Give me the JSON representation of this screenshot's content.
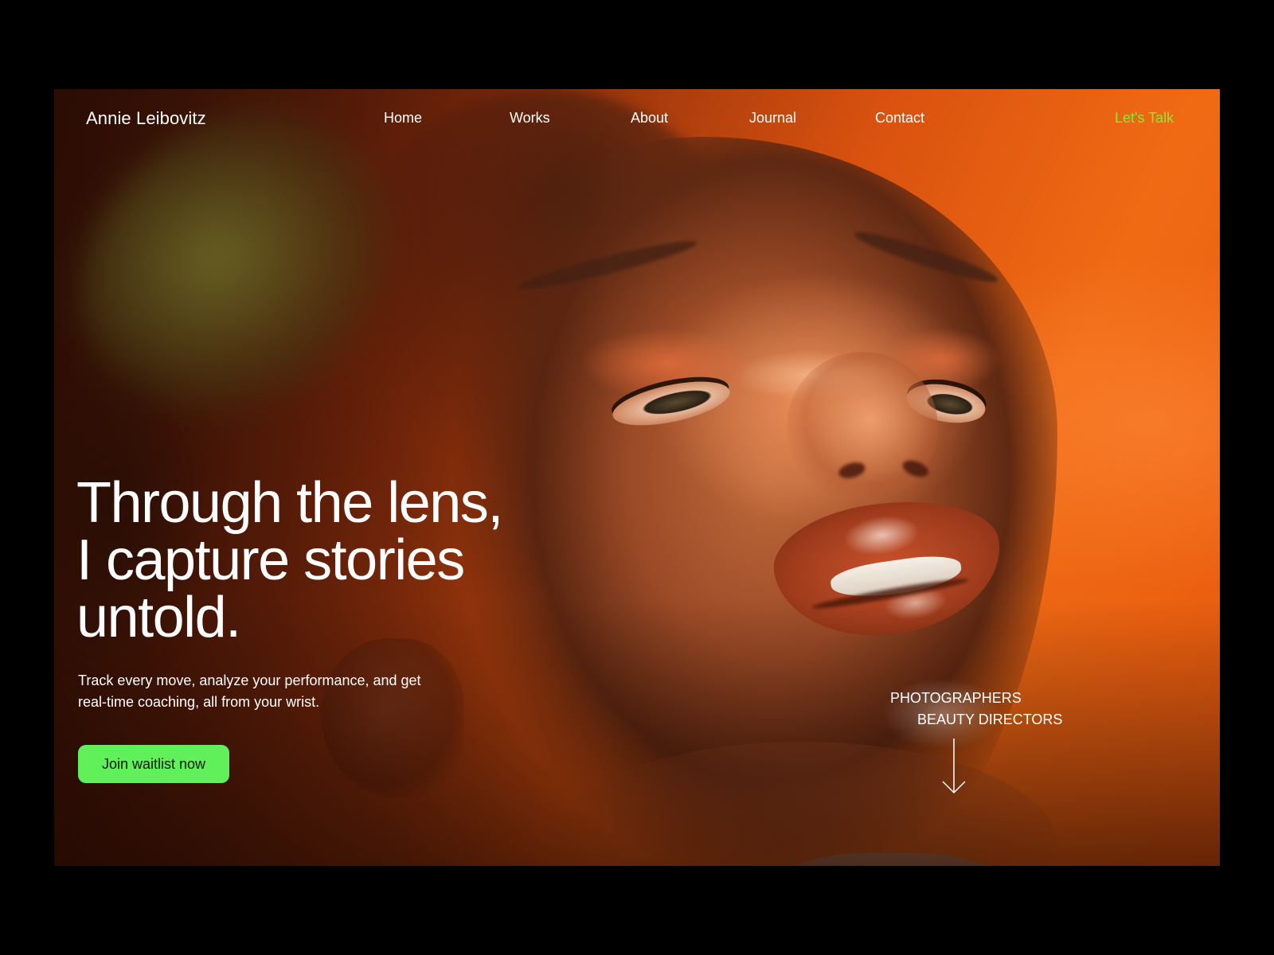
{
  "brand": {
    "name": "Annie Leibovitz"
  },
  "nav": {
    "items": [
      {
        "label": "Home"
      },
      {
        "label": "Works"
      },
      {
        "label": "About"
      },
      {
        "label": "Journal"
      },
      {
        "label": "Contact"
      }
    ],
    "cta_label": "Let's Talk"
  },
  "hero": {
    "headline_lines": [
      "Through the lens,",
      "I capture stories",
      "untold."
    ],
    "subtext_lines": [
      "Track every move, analyze your performance, and get",
      "real-time coaching, all from your wrist."
    ],
    "button_label": "Join waitlist now"
  },
  "roles": {
    "line1": "PHOTOGRAPHERS",
    "line2": "BEAUTY DIRECTORS"
  },
  "icons": {
    "scroll": "arrow-down-icon"
  },
  "colors": {
    "page_background": "#000000",
    "accent_green": "#8de830",
    "button_green": "#5ff05a",
    "hero_orange": "#e85a0e",
    "text": "#ffffff"
  }
}
